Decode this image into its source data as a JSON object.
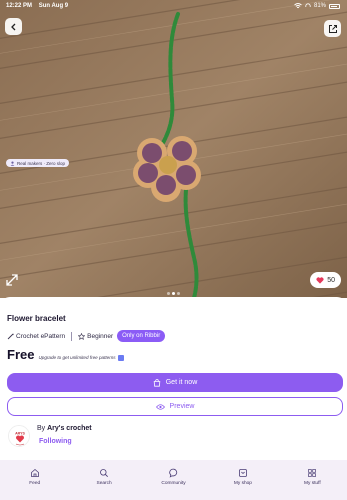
{
  "status_bar": {
    "time": "12:22 PM",
    "date": "Sun Aug 9",
    "battery": "81%"
  },
  "hero": {
    "likes": "50",
    "page_count": 3,
    "active_page": 1
  },
  "product": {
    "title": "Flower bracelet",
    "type": "Crochet ePattern",
    "level": "Beginner",
    "badge": "Only on Ribbir",
    "price": "Free",
    "upgrade_text": "Upgrade to get unlimited free patterns"
  },
  "actions": {
    "primary": "Get it now",
    "secondary": "Preview"
  },
  "seller": {
    "by": "By",
    "name": "Ary's crochet",
    "follow": "Following",
    "avatar_text": "ARYS"
  },
  "chip": {
    "label": "Real makers · Zero slop"
  },
  "tabs": [
    {
      "label": "Feed",
      "icon": "home-icon"
    },
    {
      "label": "Search",
      "icon": "search-icon"
    },
    {
      "label": "Community",
      "icon": "chat-icon"
    },
    {
      "label": "My shop",
      "icon": "shop-icon"
    },
    {
      "label": "My stuff",
      "icon": "grid-icon"
    }
  ],
  "colors": {
    "accent": "#8d5cf0",
    "badge": "#8b5cf6",
    "heart": "#e5395b",
    "tab_bg": "#f4eff8"
  }
}
